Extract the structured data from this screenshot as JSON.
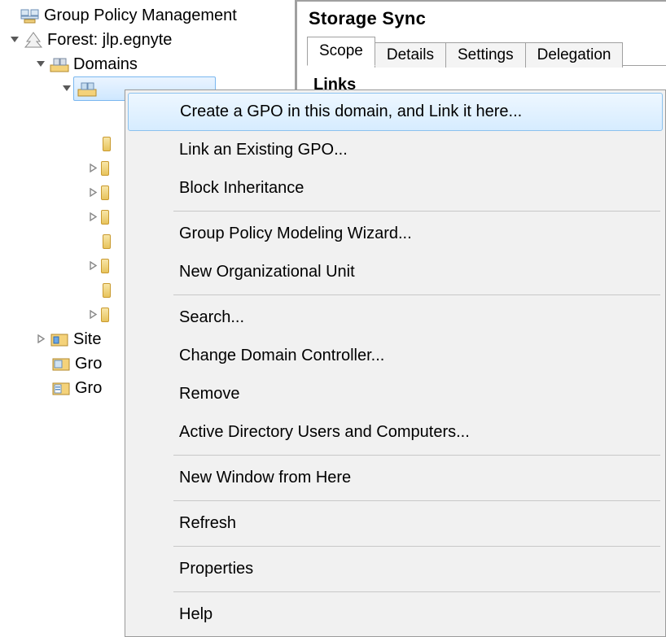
{
  "tree": {
    "root_label": "Group Policy Management",
    "forest_label": "Forest: jlp.egnyte",
    "domains_label": "Domains",
    "sites_label": "Site",
    "gpo1_label": "Gro",
    "gpo2_label": "Gro"
  },
  "right": {
    "title": "Storage Sync",
    "tabs": {
      "scope": "Scope",
      "details": "Details",
      "settings": "Settings",
      "delegation": "Delegation"
    },
    "links_heading": "Links"
  },
  "menu": {
    "create_gpo": "Create a GPO in this domain, and Link it here...",
    "link_existing": "Link an Existing GPO...",
    "block_inh": "Block Inheritance",
    "modeling": "Group Policy Modeling Wizard...",
    "new_ou": "New Organizational Unit",
    "search": "Search...",
    "change_dc": "Change Domain Controller...",
    "remove": "Remove",
    "aduc": "Active Directory Users and Computers...",
    "new_window": "New Window from Here",
    "refresh": "Refresh",
    "properties": "Properties",
    "help": "Help"
  }
}
